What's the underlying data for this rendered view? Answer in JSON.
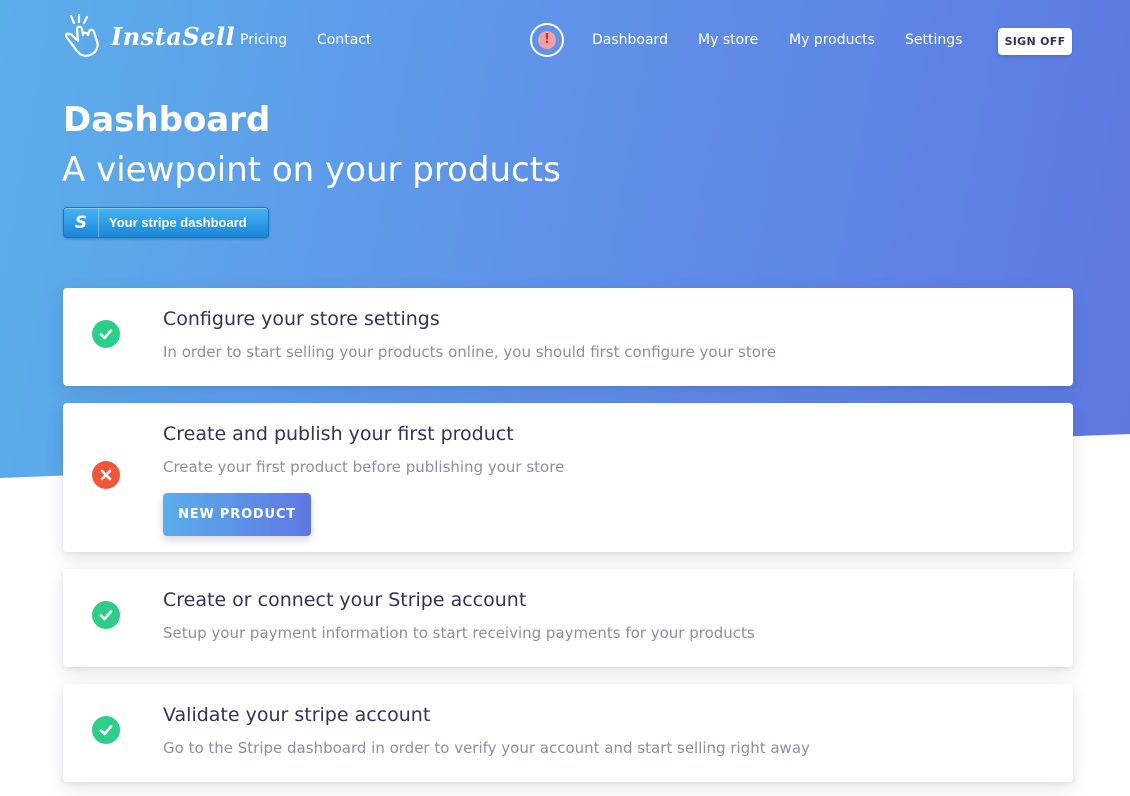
{
  "brand": {
    "name": "InstaSell",
    "logo_icon": "hand-click-icon"
  },
  "nav": {
    "left_links": [
      "Pricing",
      "Contact"
    ],
    "alert_icon": "exclamation-icon",
    "alert_glyph": "!",
    "right_links": [
      "Dashboard",
      "My store",
      "My products",
      "Settings"
    ],
    "sign_off": "SIGN OFF"
  },
  "hero": {
    "title": "Dashboard",
    "subtitle": "A viewpoint on your products",
    "stripe_button_glyph": "S",
    "stripe_button": "Your stripe dashboard"
  },
  "steps": [
    {
      "status": "done",
      "title": "Configure your store settings",
      "description": "In order to start selling your products online, you should first configure your store"
    },
    {
      "status": "todo",
      "title": "Create and publish your first product",
      "description": "Create your first product before publishing your store",
      "action": "NEW PRODUCT"
    },
    {
      "status": "done",
      "title": "Create or connect your Stripe account",
      "description": "Setup your payment information to start receiving payments for your products"
    },
    {
      "status": "done",
      "title": "Validate your stripe account",
      "description": "Go to the Stripe dashboard in order to verify your account and start selling right away"
    }
  ],
  "colors": {
    "gradient_start": "#5aaeea",
    "gradient_end": "#5e78e2",
    "success": "#2dce89",
    "error": "#f0563a",
    "heading": "#32325d",
    "muted": "#8a8fa8"
  }
}
